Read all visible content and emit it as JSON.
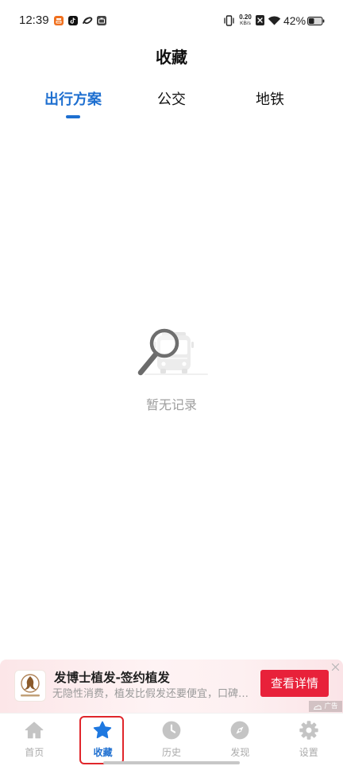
{
  "status_bar": {
    "time": "12:39",
    "apps": [
      "orange-app-icon",
      "tiktok-icon",
      "link-app-icon",
      "wallet-app-icon"
    ],
    "vibrate_icon": "vibrate-icon",
    "net_speed": "0.20",
    "net_speed_unit": "KB/s",
    "sim_icon": "no-sim-icon",
    "wifi_icon": "wifi-icon",
    "battery_text": "42%",
    "battery_level": 0.42
  },
  "header": {
    "title": "收藏"
  },
  "tabs": [
    {
      "label": "出行方案",
      "active": true
    },
    {
      "label": "公交",
      "active": false
    },
    {
      "label": "地铁",
      "active": false
    }
  ],
  "empty_state": {
    "icon": "search-bus-illustration",
    "text": "暂无记录"
  },
  "ad": {
    "logo_icon": "clinic-logo",
    "title": "发博士植发-签约植发",
    "subtitle": "无隐性消费，植发比假发还要便宜，口碑…",
    "button_label": "查看详情",
    "tag": "广告",
    "close_icon": "close-icon"
  },
  "bottom_nav": [
    {
      "label": "首页",
      "icon": "home-icon",
      "active": false
    },
    {
      "label": "收藏",
      "icon": "star-icon",
      "active": true
    },
    {
      "label": "历史",
      "icon": "clock-icon",
      "active": false
    },
    {
      "label": "发现",
      "icon": "compass-icon",
      "active": false
    },
    {
      "label": "设置",
      "icon": "gear-icon",
      "active": false
    }
  ],
  "colors": {
    "accent": "#1E6FD0",
    "tab_text": "#111111",
    "nav_inactive": "#ABABAB",
    "nav_icon_inactive": "#C4C4C4",
    "ad_button": "#E8213A",
    "highlight": "#E0262B",
    "empty_text": "#9E9E9E"
  }
}
